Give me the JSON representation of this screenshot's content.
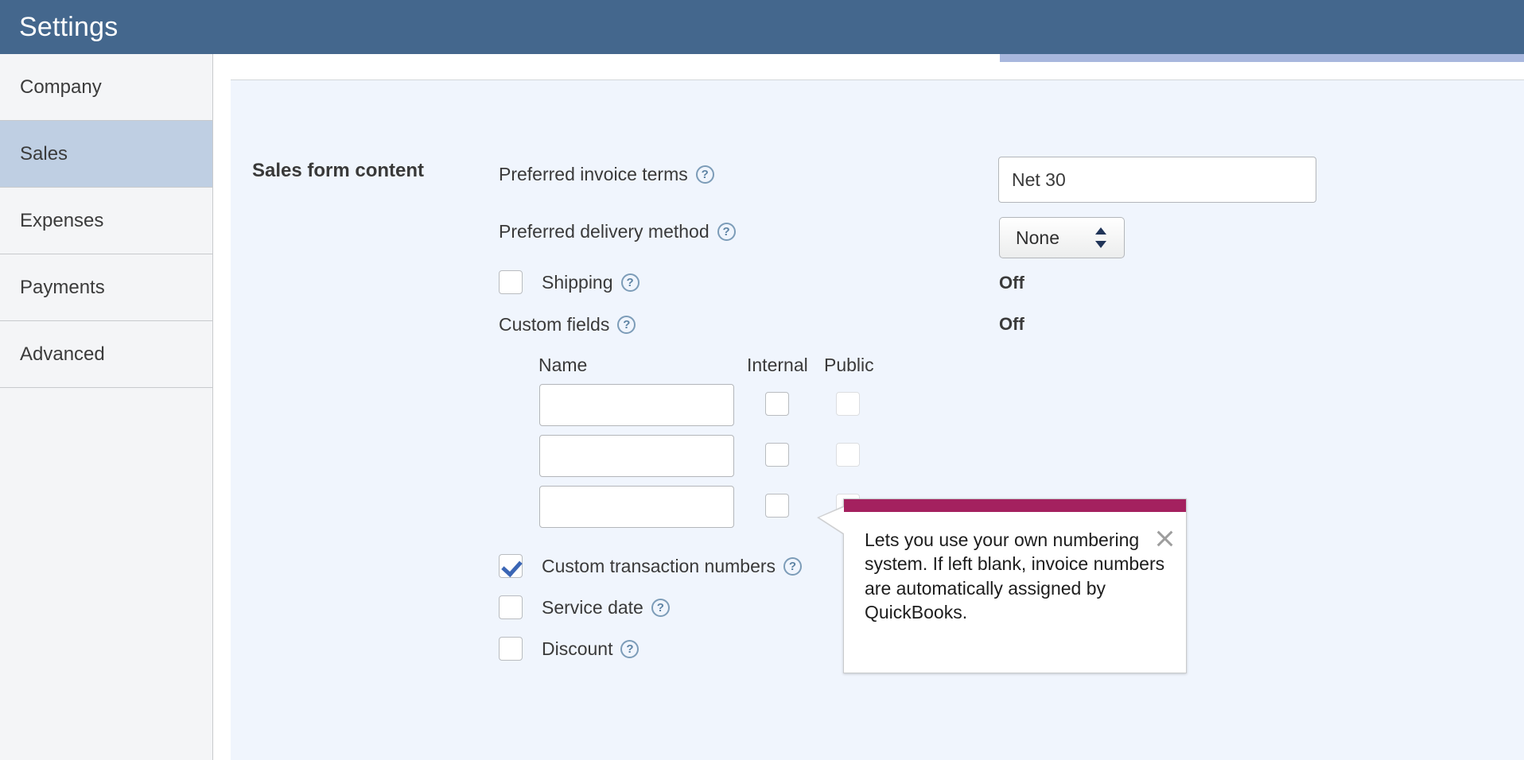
{
  "header": {
    "title": "Settings"
  },
  "sidebar": {
    "items": [
      {
        "label": "Company",
        "active": false
      },
      {
        "label": "Sales",
        "active": true
      },
      {
        "label": "Expenses",
        "active": false
      },
      {
        "label": "Payments",
        "active": false
      },
      {
        "label": "Advanced",
        "active": false
      }
    ]
  },
  "main": {
    "section_title": "Sales form content",
    "fields": {
      "preferred_invoice_terms": {
        "label": "Preferred invoice terms",
        "help_icon": "help-circle-icon",
        "value": "Net 30"
      },
      "preferred_delivery_method": {
        "label": "Preferred delivery method",
        "help_icon": "help-circle-icon",
        "value": "None",
        "options": [
          "None"
        ]
      },
      "shipping": {
        "label": "Shipping",
        "help_icon": "help-circle-icon",
        "checked": false,
        "status": "Off"
      },
      "custom_fields": {
        "label": "Custom fields",
        "help_icon": "help-circle-icon",
        "status": "Off",
        "columns": [
          "Name",
          "Internal",
          "Public"
        ],
        "rows": [
          {
            "name": "",
            "internal": false,
            "public": false
          },
          {
            "name": "",
            "internal": false,
            "public": false
          },
          {
            "name": "",
            "internal": false,
            "public": false
          }
        ]
      },
      "custom_transaction_numbers": {
        "label": "Custom transaction numbers",
        "help_icon": "help-circle-icon",
        "checked": true
      },
      "service_date": {
        "label": "Service date",
        "help_icon": "help-circle-icon",
        "checked": false
      },
      "discount": {
        "label": "Discount",
        "help_icon": "help-circle-icon",
        "checked": false
      }
    }
  },
  "tooltip": {
    "text": "Lets you use your own numbering system. If left blank, invoice numbers are automatically assigned by QuickBooks.",
    "close_icon": "close-x-icon",
    "accent_color": "#a4215f"
  },
  "colors": {
    "header_bg": "#44678d",
    "sidebar_bg": "#f4f5f7",
    "sidebar_active": "#bfcfe3",
    "panel_bg": "#f0f5fd",
    "accent_strip": "#a8b7dd",
    "checkbox_check": "#3b66b5",
    "help_icon": "#5d83a4"
  }
}
